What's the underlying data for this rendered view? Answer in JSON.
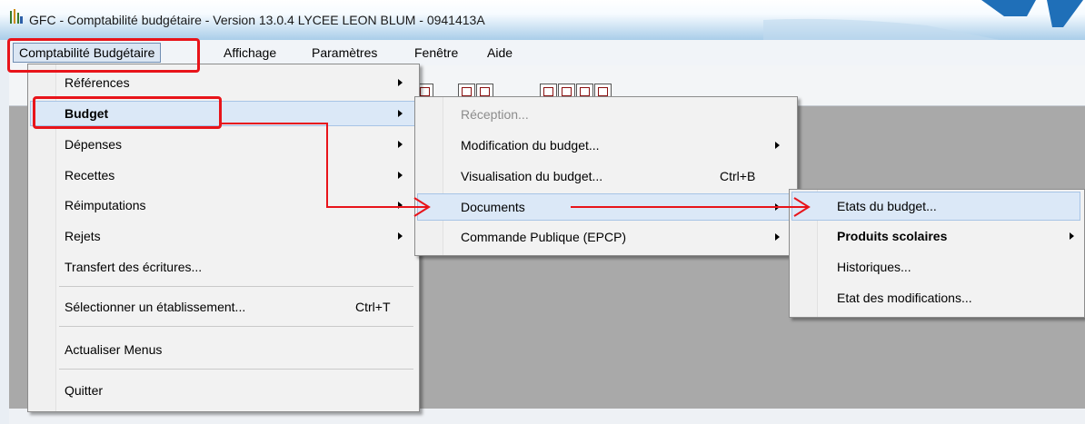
{
  "window": {
    "title": "GFC - Comptabilité budgétaire - Version 13.0.4   LYCEE LEON BLUM - 0941413A"
  },
  "menubar": {
    "items": [
      "Comptabilité Budgétaire",
      "Affichage",
      "Paramètres",
      "Fenêtre",
      "Aide"
    ]
  },
  "main_menu": {
    "items": [
      {
        "label": "Références",
        "submenu": true
      },
      {
        "label": "Budget",
        "submenu": true,
        "highlighted": true
      },
      {
        "label": "Dépenses",
        "submenu": true
      },
      {
        "label": "Recettes",
        "submenu": true
      },
      {
        "label": "Réimputations",
        "submenu": true
      },
      {
        "label": "Rejets",
        "submenu": true
      },
      {
        "label": "Transfert des écritures...",
        "submenu": false
      },
      {
        "label": "Sélectionner un établissement...",
        "shortcut": "Ctrl+T"
      },
      {
        "label": "Actualiser Menus"
      },
      {
        "label": "Quitter"
      }
    ]
  },
  "budget_menu": {
    "items": [
      {
        "label": "Réception...",
        "disabled": true
      },
      {
        "label": "Modification du budget...",
        "submenu": true
      },
      {
        "label": "Visualisation du budget...",
        "shortcut": "Ctrl+B"
      },
      {
        "label": "Documents",
        "submenu": true,
        "highlighted": true
      },
      {
        "label": "Commande Publique (EPCP)",
        "submenu": true
      }
    ]
  },
  "documents_menu": {
    "items": [
      {
        "label": "Etats du budget...",
        "highlighted": true
      },
      {
        "label": "Produits scolaires",
        "submenu": true
      },
      {
        "label": "Historiques..."
      },
      {
        "label": "Etat des modifications..."
      }
    ]
  },
  "icons": {
    "app": "gfc-app-icon",
    "submenu": "submenu-arrow-icon",
    "toolbar": "toolbar-document-icon"
  },
  "colors": {
    "annotation": "#e8141a",
    "highlight": "#dbe8f7",
    "workspace": "#a9a9a9"
  }
}
